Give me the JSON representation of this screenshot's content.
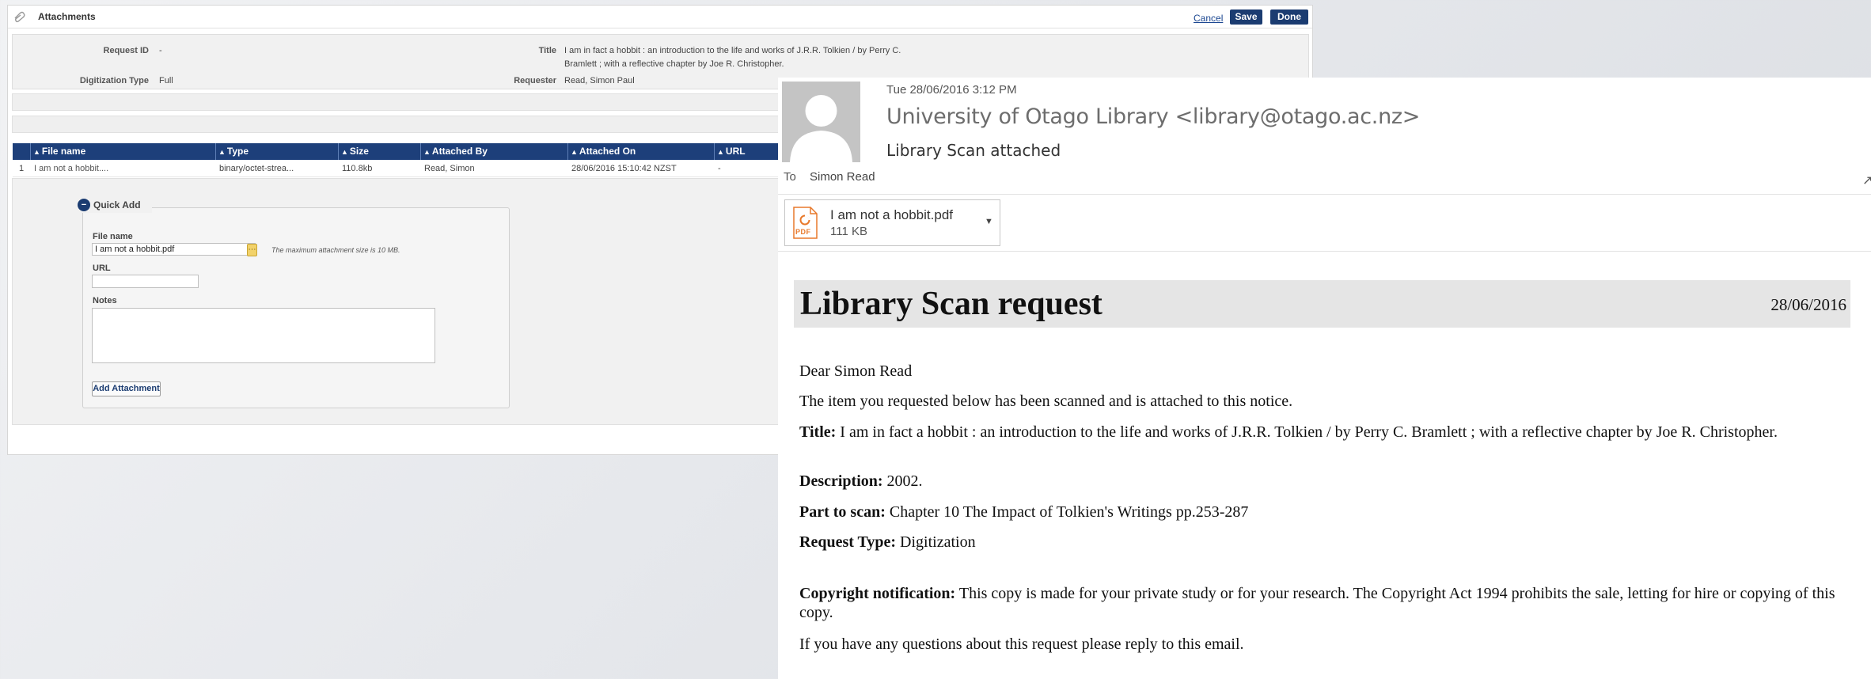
{
  "left": {
    "title": "Attachments",
    "cancel": "Cancel",
    "save": "Save",
    "done": "Done",
    "info": {
      "request_id_label": "Request ID",
      "request_id_value": "-",
      "digitization_type_label": "Digitization Type",
      "digitization_type_value": "Full",
      "title_label": "Title",
      "title_value_line1": "I am in fact a hobbit : an introduction to the life and works of J.R.R. Tolkien / by Perry C.",
      "title_value_line2": "Bramlett ; with a reflective chapter by Joe R. Christopher.",
      "requester_label": "Requester",
      "requester_value": "Read, Simon Paul"
    },
    "table": {
      "headers": [
        "File name",
        "Type",
        "Size",
        "Attached By",
        "Attached On",
        "URL"
      ],
      "rows": [
        {
          "index": "1",
          "file_name": "I am not a hobbit....",
          "type": "binary/octet-strea...",
          "size": "110.8kb",
          "attached_by": "Read, Simon",
          "attached_on": "28/06/2016 15:10:42 NZST",
          "url": "-"
        }
      ]
    },
    "quick_add": {
      "legend": "Quick Add",
      "file_name_label": "File name",
      "file_name_value": "I am not a hobbit.pdf",
      "hint": "The maximum attachment size is 10 MB.",
      "url_label": "URL",
      "url_value": "",
      "notes_label": "Notes",
      "add_button": "Add Attachment"
    }
  },
  "email": {
    "date": "Tue 28/06/2016 3:12 PM",
    "from": "University of Otago Library <library@otago.ac.nz>",
    "subject": "Library Scan attached",
    "to_label": "To",
    "to_value": "Simon Read",
    "attachment": {
      "name": "I am not a hobbit.pdf",
      "size": "111 KB",
      "icon_text": "PDF"
    },
    "body": {
      "heading": "Library Scan request",
      "date": "28/06/2016",
      "greeting": "Dear Simon Read",
      "intro": "The item you requested below has been scanned and is attached to this notice.",
      "title_label": "Title:",
      "title_value": "I am in fact a hobbit : an introduction to the life and works of J.R.R. Tolkien / by Perry C. Bramlett ; with a reflective chapter by Joe R. Christopher.",
      "description_label": "Description:",
      "description_value": "2002.",
      "part_label": "Part to scan:",
      "part_value": "Chapter 10 The Impact of Tolkien's Writings pp.253-287",
      "request_type_label": "Request Type:",
      "request_type_value": "Digitization",
      "copyright_label": "Copyright notification:",
      "copyright_value": "This copy is made for your private study or for your research. The Copyright Act 1994 prohibits the sale, letting for hire or copying of this copy.",
      "closing": "If you have any questions about this request please reply to this email."
    }
  },
  "colors": {
    "header_navy": "#1d3f7a",
    "button_navy": "#1b3c71",
    "link_blue": "#1a4691",
    "pdf_orange": "#e8792b"
  }
}
